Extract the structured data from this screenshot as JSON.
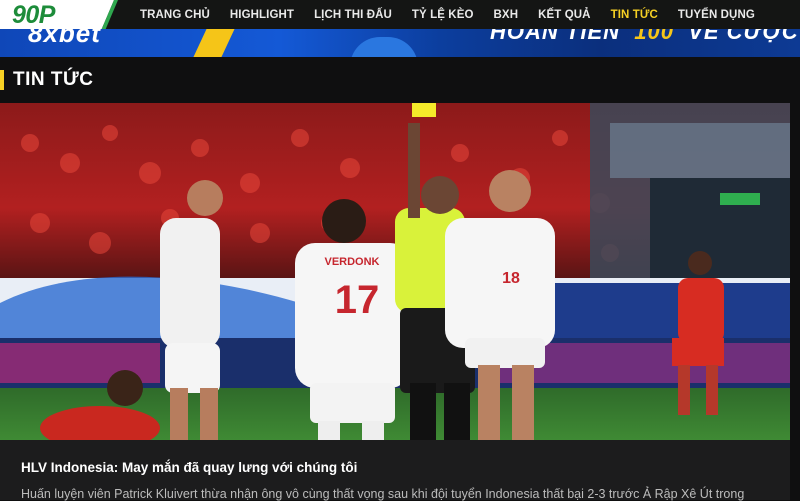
{
  "header": {
    "logo_text": "90P",
    "menu": [
      {
        "label": "TRANG CHỦ",
        "active": false
      },
      {
        "label": "HIGHLIGHT",
        "active": false
      },
      {
        "label": "LỊCH THI ĐẤU",
        "active": false
      },
      {
        "label": "TỶ LỆ KÈO",
        "active": false
      },
      {
        "label": "BXH",
        "active": false
      },
      {
        "label": "KẾT QUẢ",
        "active": false
      },
      {
        "label": "TIN TỨC",
        "active": true
      },
      {
        "label": "TUYỂN DỤNG",
        "active": false
      }
    ],
    "active_color": "#f6d024"
  },
  "banner": {
    "brand": "8xbet",
    "promo_prefix": "HOÀN TIỀN",
    "promo_highlight": "100",
    "promo_suffix": "VỀ CƯỢC"
  },
  "section": {
    "title": "TIN TỨC",
    "accent_color": "#f6d024"
  },
  "article": {
    "image_alt": "football-match-photo",
    "title": "HLV Indonesia: May mắn đã quay lưng với chúng tôi",
    "excerpt": "Huấn luyện viên Patrick Kluivert thừa nhận ông vô cùng thất vọng sau khi đội tuyển Indonesia thất bại 2-3 trước Ả Rập Xê Út trong",
    "jersey_names": {
      "player_17": "VERDONK",
      "number_17": "17",
      "number_18": "18"
    }
  }
}
